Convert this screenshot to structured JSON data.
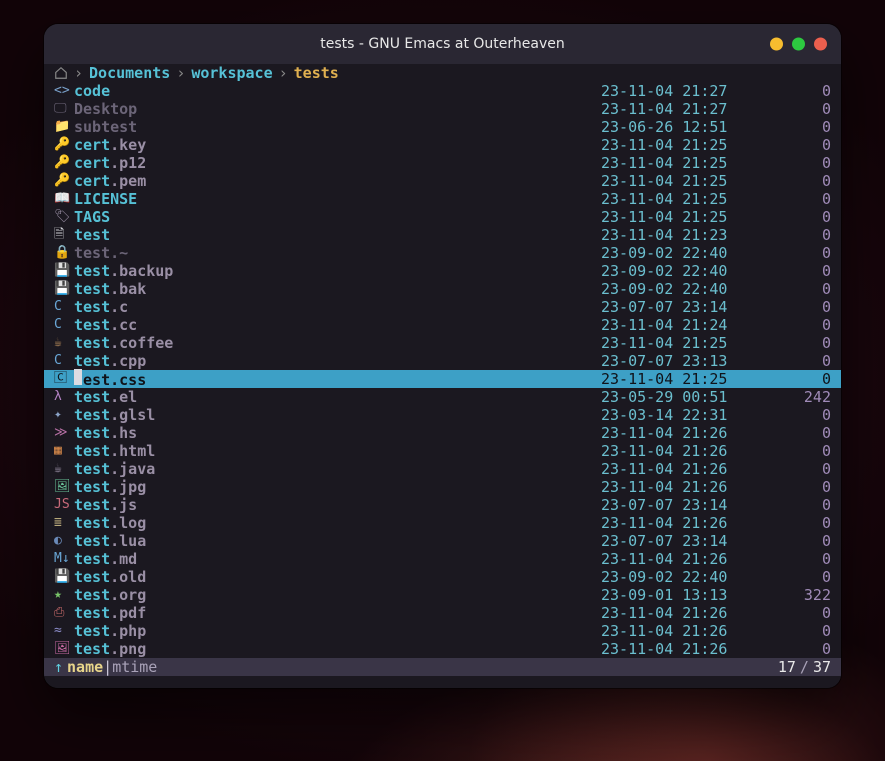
{
  "window": {
    "title": "tests - GNU Emacs at Outerheaven"
  },
  "breadcrumb": {
    "segments": [
      {
        "label": "Documents",
        "active": false
      },
      {
        "label": "workspace",
        "active": false
      },
      {
        "label": "tests",
        "active": true
      }
    ]
  },
  "colors": {
    "accent": "#56c1d6",
    "highlight": "#3da0c6",
    "background": "#1b1820",
    "titlebar": "#2a2733"
  },
  "status": {
    "sort_indicator": "↑",
    "sort_active": "name",
    "sort_separator": "|",
    "sort_other": "mtime",
    "position_current": "17",
    "position_separator": "/",
    "position_total": "37"
  },
  "selected_index": 17,
  "files": [
    {
      "icon": "code-icon",
      "icon_color": "#7aa2cc",
      "base": "code",
      "ext": "",
      "dim": false,
      "mtime": "23-11-04 21:27",
      "size": "0"
    },
    {
      "icon": "desktop-icon",
      "icon_color": "#777",
      "base": "Desktop",
      "ext": "",
      "dim": true,
      "mtime": "23-11-04 21:27",
      "size": "0"
    },
    {
      "icon": "folder-icon",
      "icon_color": "#4aa3d6",
      "base": "subtest",
      "ext": "",
      "dim": true,
      "mtime": "23-06-26 12:51",
      "size": "0"
    },
    {
      "icon": "key-icon",
      "icon_color": "#c9b36a",
      "base": "cert",
      "ext": "key",
      "dim": false,
      "mtime": "23-11-04 21:25",
      "size": "0"
    },
    {
      "icon": "key-icon",
      "icon_color": "#c9b36a",
      "base": "cert",
      "ext": "p12",
      "dim": false,
      "mtime": "23-11-04 21:25",
      "size": "0"
    },
    {
      "icon": "key-icon",
      "icon_color": "#c9b36a",
      "base": "cert",
      "ext": "pem",
      "dim": false,
      "mtime": "23-11-04 21:25",
      "size": "0"
    },
    {
      "icon": "book-icon",
      "icon_color": "#9a8fa5",
      "base": "LICENSE",
      "ext": "",
      "dim": false,
      "mtime": "23-11-04 21:25",
      "size": "0"
    },
    {
      "icon": "tag-icon",
      "icon_color": "#9a8fa5",
      "base": "TAGS",
      "ext": "",
      "dim": false,
      "mtime": "23-11-04 21:25",
      "size": "0"
    },
    {
      "icon": "file-icon",
      "icon_color": "#cfcfd5",
      "base": "test",
      "ext": "",
      "dim": false,
      "mtime": "23-11-04 21:23",
      "size": "0"
    },
    {
      "icon": "lock-icon",
      "icon_color": "#d08a6a",
      "base": "test",
      "ext": "~",
      "dim": true,
      "mtime": "23-09-02 22:40",
      "size": "0"
    },
    {
      "icon": "backup-icon",
      "icon_color": "#8aa2c6",
      "base": "test",
      "ext": "backup",
      "dim": false,
      "mtime": "23-09-02 22:40",
      "size": "0"
    },
    {
      "icon": "backup-icon",
      "icon_color": "#8aa2c6",
      "base": "test",
      "ext": "bak",
      "dim": false,
      "mtime": "23-09-02 22:40",
      "size": "0"
    },
    {
      "icon": "c-icon",
      "icon_color": "#6aa8d8",
      "base": "test",
      "ext": "c",
      "dim": false,
      "mtime": "23-07-07 23:14",
      "size": "0"
    },
    {
      "icon": "c-icon",
      "icon_color": "#6aa8d8",
      "base": "test",
      "ext": "cc",
      "dim": false,
      "mtime": "23-11-04 21:24",
      "size": "0"
    },
    {
      "icon": "coffee-icon",
      "icon_color": "#b58a5a",
      "base": "test",
      "ext": "coffee",
      "dim": false,
      "mtime": "23-11-04 21:25",
      "size": "0"
    },
    {
      "icon": "c-icon",
      "icon_color": "#6aa8d8",
      "base": "test",
      "ext": "cpp",
      "dim": false,
      "mtime": "23-07-07 23:13",
      "size": "0"
    },
    {
      "icon": "css-icon",
      "icon_color": "#4aa3d6",
      "base": "test",
      "ext": "css",
      "dim": false,
      "mtime": "23-11-04 21:25",
      "size": "0"
    },
    {
      "icon": "el-icon",
      "icon_color": "#b583c6",
      "base": "test",
      "ext": "el",
      "dim": false,
      "mtime": "23-05-29 00:51",
      "size": "242"
    },
    {
      "icon": "shader-icon",
      "icon_color": "#8aa2c6",
      "base": "test",
      "ext": "glsl",
      "dim": false,
      "mtime": "23-03-14 22:31",
      "size": "0"
    },
    {
      "icon": "haskell-icon",
      "icon_color": "#b56fa3",
      "base": "test",
      "ext": "hs",
      "dim": false,
      "mtime": "23-11-04 21:26",
      "size": "0"
    },
    {
      "icon": "html-icon",
      "icon_color": "#d88a4a",
      "base": "test",
      "ext": "html",
      "dim": false,
      "mtime": "23-11-04 21:26",
      "size": "0"
    },
    {
      "icon": "java-icon",
      "icon_color": "#9a8fa5",
      "base": "test",
      "ext": "java",
      "dim": false,
      "mtime": "23-11-04 21:26",
      "size": "0"
    },
    {
      "icon": "image-icon",
      "icon_color": "#6ac69a",
      "base": "test",
      "ext": "jpg",
      "dim": false,
      "mtime": "23-11-04 21:26",
      "size": "0"
    },
    {
      "icon": "js-icon",
      "icon_color": "#c96a7a",
      "base": "test",
      "ext": "js",
      "dim": false,
      "mtime": "23-07-07 23:14",
      "size": "0"
    },
    {
      "icon": "log-icon",
      "icon_color": "#b8a97a",
      "base": "test",
      "ext": "log",
      "dim": false,
      "mtime": "23-11-04 21:26",
      "size": "0"
    },
    {
      "icon": "lua-icon",
      "icon_color": "#6a8ab8",
      "base": "test",
      "ext": "lua",
      "dim": false,
      "mtime": "23-07-07 23:14",
      "size": "0"
    },
    {
      "icon": "md-icon",
      "icon_color": "#6aa8d8",
      "base": "test",
      "ext": "md",
      "dim": false,
      "mtime": "23-11-04 21:26",
      "size": "0"
    },
    {
      "icon": "backup-icon",
      "icon_color": "#8aa2c6",
      "base": "test",
      "ext": "old",
      "dim": false,
      "mtime": "23-09-02 22:40",
      "size": "0"
    },
    {
      "icon": "org-icon",
      "icon_color": "#7ac66a",
      "base": "test",
      "ext": "org",
      "dim": false,
      "mtime": "23-09-01 13:13",
      "size": "322"
    },
    {
      "icon": "pdf-icon",
      "icon_color": "#c96a6a",
      "base": "test",
      "ext": "pdf",
      "dim": false,
      "mtime": "23-11-04 21:26",
      "size": "0"
    },
    {
      "icon": "php-icon",
      "icon_color": "#8a8ac6",
      "base": "test",
      "ext": "php",
      "dim": false,
      "mtime": "23-11-04 21:26",
      "size": "0"
    },
    {
      "icon": "image-icon",
      "icon_color": "#c96aa3",
      "base": "test",
      "ext": "png",
      "dim": false,
      "mtime": "23-11-04 21:26",
      "size": "0"
    }
  ],
  "icon_glyphs": {
    "code-icon": "<>",
    "desktop-icon": "🖵",
    "folder-icon": "📁",
    "key-icon": "🔑",
    "book-icon": "📖",
    "tag-icon": "🏷",
    "file-icon": "🗎",
    "lock-icon": "🔒",
    "backup-icon": "💾",
    "c-icon": "C",
    "coffee-icon": "☕",
    "css-icon": "🄲",
    "el-icon": "λ",
    "shader-icon": "✦",
    "haskell-icon": "≫",
    "html-icon": "▦",
    "java-icon": "☕",
    "image-icon": "🖼",
    "js-icon": "JS",
    "log-icon": "≣",
    "lua-icon": "◐",
    "md-icon": "M↓",
    "org-icon": "★",
    "pdf-icon": "⎙",
    "php-icon": "≈",
    "home-icon": "⌂"
  }
}
